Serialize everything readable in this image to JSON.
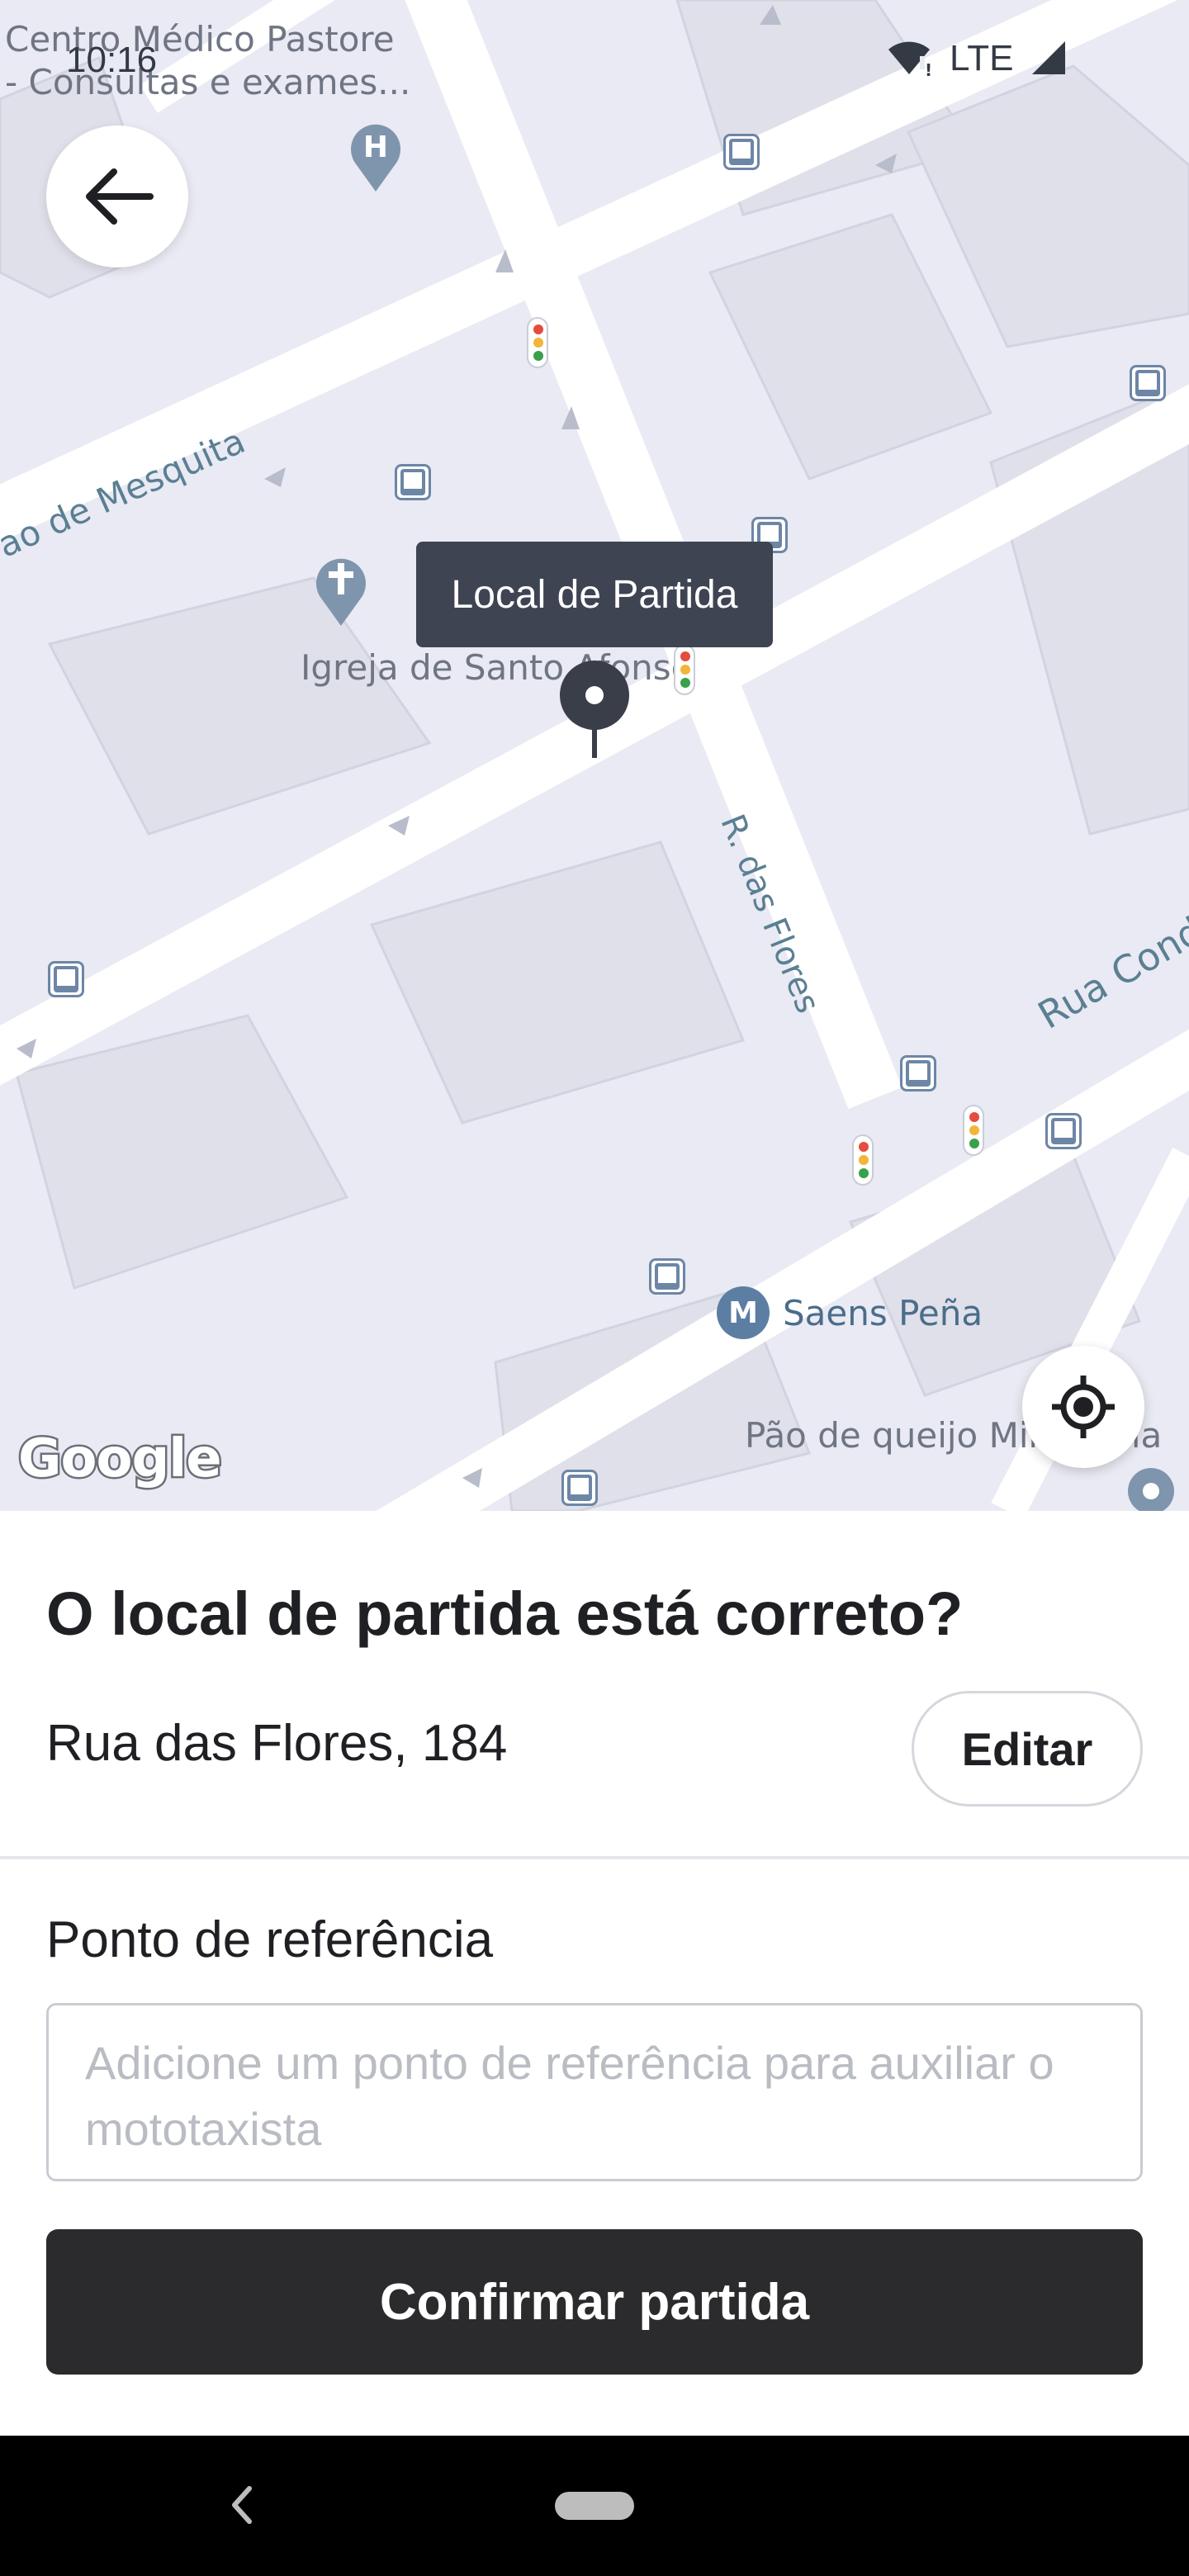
{
  "status_bar": {
    "time": "10:16",
    "network": "LTE"
  },
  "map": {
    "labels": {
      "poi_top": "Centro Médico Pastore\n- Consultas e exames...",
      "street_mesquita": "ao de Mesquita",
      "church": "Igreja de Santo Afonso",
      "street_flores": "R. das Flores",
      "street_cond": "Rua Cond",
      "metro": "Saens Peña",
      "bakery": "Pão de queijo Mineiraria"
    },
    "pin_tooltip": "Local de Partida",
    "attribution": "Google",
    "colors": {
      "background": "#e9eaf3",
      "road": "#ffffff",
      "block": "#dcdde8"
    }
  },
  "sheet": {
    "title": "O local de partida está correto?",
    "address": "Rua das Flores, 184",
    "edit_label": "Editar",
    "reference_label": "Ponto de referência",
    "reference_placeholder": "Adicione um ponto de referência para auxiliar o mototaxista",
    "reference_value": "",
    "confirm_label": "Confirmar partida"
  },
  "icons": {
    "back": "arrow-left-icon",
    "locate": "crosshair-icon",
    "pin": "map-pin-icon",
    "hospital": "hospital-icon",
    "church": "church-icon",
    "metro": "metro-icon",
    "bus": "bus-stop-icon",
    "traffic_light": "traffic-light-icon"
  },
  "accent_colors": {
    "primary_button": "#2b2b2d",
    "tooltip": "#3e4452"
  }
}
